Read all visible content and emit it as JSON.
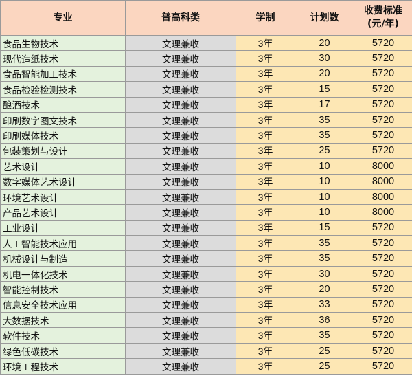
{
  "table": {
    "headers": {
      "major": "专业",
      "category": "普高科类",
      "years": "学制",
      "plan": "计划数",
      "fee_line1": "收费标准",
      "fee_line2": "(元/年)"
    },
    "rows": [
      {
        "major": "食品生物技术",
        "category": "文理兼收",
        "years": "3年",
        "plan": "20",
        "fee": "5720"
      },
      {
        "major": "现代造纸技术",
        "category": "文理兼收",
        "years": "3年",
        "plan": "30",
        "fee": "5720"
      },
      {
        "major": "食品智能加工技术",
        "category": "文理兼收",
        "years": "3年",
        "plan": "20",
        "fee": "5720"
      },
      {
        "major": "食品检验检测技术",
        "category": "文理兼收",
        "years": "3年",
        "plan": "15",
        "fee": "5720"
      },
      {
        "major": "酿酒技术",
        "category": "文理兼收",
        "years": "3年",
        "plan": "17",
        "fee": "5720"
      },
      {
        "major": "印刷数字图文技术",
        "category": "文理兼收",
        "years": "3年",
        "plan": "35",
        "fee": "5720"
      },
      {
        "major": "印刷媒体技术",
        "category": "文理兼收",
        "years": "3年",
        "plan": "35",
        "fee": "5720"
      },
      {
        "major": "包装策划与设计",
        "category": "文理兼收",
        "years": "3年",
        "plan": "25",
        "fee": "5720"
      },
      {
        "major": "艺术设计",
        "category": "文理兼收",
        "years": "3年",
        "plan": "10",
        "fee": "8000"
      },
      {
        "major": "数字媒体艺术设计",
        "category": "文理兼收",
        "years": "3年",
        "plan": "10",
        "fee": "8000"
      },
      {
        "major": "环境艺术设计",
        "category": "文理兼收",
        "years": "3年",
        "plan": "10",
        "fee": "8000"
      },
      {
        "major": "产品艺术设计",
        "category": "文理兼收",
        "years": "3年",
        "plan": "10",
        "fee": "8000"
      },
      {
        "major": "工业设计",
        "category": "文理兼收",
        "years": "3年",
        "plan": "15",
        "fee": "5720"
      },
      {
        "major": "人工智能技术应用",
        "category": "文理兼收",
        "years": "3年",
        "plan": "35",
        "fee": "5720"
      },
      {
        "major": "机械设计与制造",
        "category": "文理兼收",
        "years": "3年",
        "plan": "35",
        "fee": "5720"
      },
      {
        "major": "机电一体化技术",
        "category": "文理兼收",
        "years": "3年",
        "plan": "30",
        "fee": "5720"
      },
      {
        "major": "智能控制技术",
        "category": "文理兼收",
        "years": "3年",
        "plan": "20",
        "fee": "5720"
      },
      {
        "major": "信息安全技术应用",
        "category": "文理兼收",
        "years": "3年",
        "plan": "33",
        "fee": "5720"
      },
      {
        "major": "大数据技术",
        "category": "文理兼收",
        "years": "3年",
        "plan": "36",
        "fee": "5720"
      },
      {
        "major": "软件技术",
        "category": "文理兼收",
        "years": "3年",
        "plan": "35",
        "fee": "5720"
      },
      {
        "major": "绿色低碳技术",
        "category": "文理兼收",
        "years": "3年",
        "plan": "25",
        "fee": "5720"
      },
      {
        "major": "环境工程技术",
        "category": "文理兼收",
        "years": "3年",
        "plan": "25",
        "fee": "5720"
      }
    ]
  },
  "colors": {
    "header_bg": "#fbd6c0",
    "major_bg": "#e4f2dd",
    "category_bg": "#dcdcdc",
    "numeric_bg": "#fde7b4",
    "grid_line": "#9a9a9a"
  }
}
